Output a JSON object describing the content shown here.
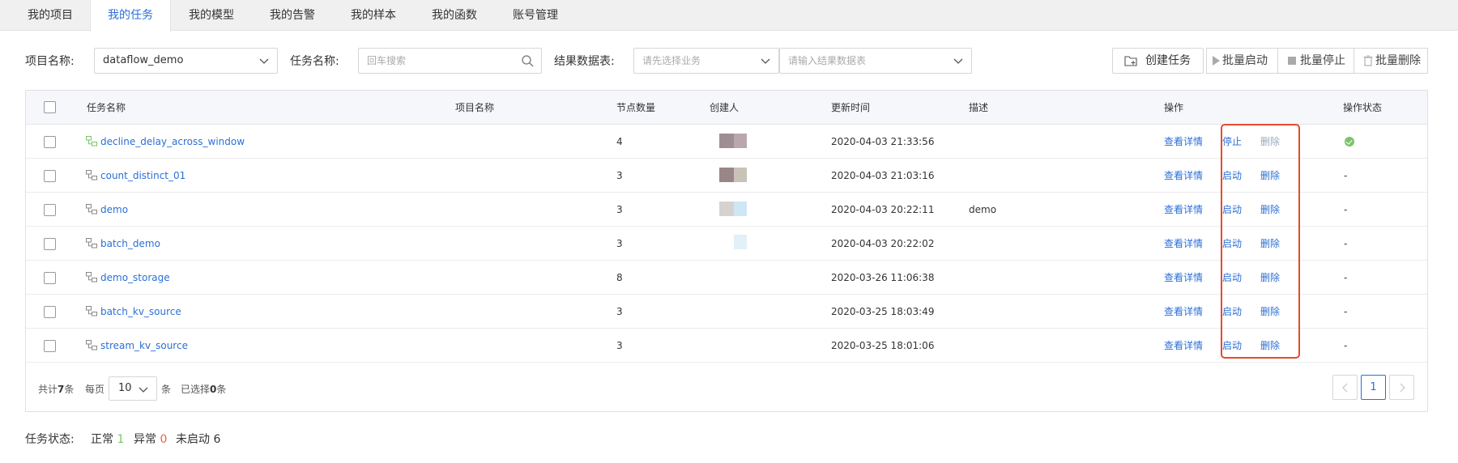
{
  "tabs": [
    "我的项目",
    "我的任务",
    "我的模型",
    "我的告警",
    "我的样本",
    "我的函数",
    "账号管理"
  ],
  "active_tab": "我的任务",
  "filters": {
    "project_label": "项目名称:",
    "project_value": "dataflow_demo",
    "task_label": "任务名称:",
    "task_placeholder": "回车搜索",
    "result_label": "结果数据表:",
    "business_placeholder": "请先选择业务",
    "table_placeholder": "请输入结果数据表"
  },
  "actions": {
    "create": "创建任务",
    "batch_start": "批量启动",
    "batch_stop": "批量停止",
    "batch_delete": "批量删除"
  },
  "columns": {
    "name": "任务名称",
    "project": "项目名称",
    "nodes": "节点数量",
    "creator": "创建人",
    "updated": "更新时间",
    "desc": "描述",
    "ops": "操作",
    "op_status": "操作状态"
  },
  "rows": [
    {
      "name": "decline_delay_across_window",
      "nodes": "4",
      "updated": "2020-04-03 21:33:56",
      "desc": "",
      "detail": "查看详情",
      "toggle": "停止",
      "delete": "删除",
      "delete_disabled": true,
      "status": "ok",
      "status_text": "",
      "running": true
    },
    {
      "name": "count_distinct_01",
      "nodes": "3",
      "updated": "2020-04-03 21:03:16",
      "desc": "",
      "detail": "查看详情",
      "toggle": "启动",
      "delete": "删除",
      "delete_disabled": false,
      "status": "none",
      "status_text": "-",
      "running": false
    },
    {
      "name": "demo",
      "nodes": "3",
      "updated": "2020-04-03 20:22:11",
      "desc": "demo",
      "detail": "查看详情",
      "toggle": "启动",
      "delete": "删除",
      "delete_disabled": false,
      "status": "none",
      "status_text": "-",
      "running": false
    },
    {
      "name": "batch_demo",
      "nodes": "3",
      "updated": "2020-04-03 20:22:02",
      "desc": "",
      "detail": "查看详情",
      "toggle": "启动",
      "delete": "删除",
      "delete_disabled": false,
      "status": "none",
      "status_text": "-",
      "running": false
    },
    {
      "name": "demo_storage",
      "nodes": "8",
      "updated": "2020-03-26 11:06:38",
      "desc": "",
      "detail": "查看详情",
      "toggle": "启动",
      "delete": "删除",
      "delete_disabled": false,
      "status": "none",
      "status_text": "-",
      "running": false
    },
    {
      "name": "batch_kv_source",
      "nodes": "3",
      "updated": "2020-03-25 18:03:49",
      "desc": "",
      "detail": "查看详情",
      "toggle": "启动",
      "delete": "删除",
      "delete_disabled": false,
      "status": "none",
      "status_text": "-",
      "running": false
    },
    {
      "name": "stream_kv_source",
      "nodes": "3",
      "updated": "2020-03-25 18:01:06",
      "desc": "",
      "detail": "查看详情",
      "toggle": "启动",
      "delete": "删除",
      "delete_disabled": false,
      "status": "none",
      "status_text": "-",
      "running": false
    }
  ],
  "footer": {
    "total_prefix": "共计",
    "total": "7",
    "total_suffix": "条",
    "per_page_label": "每页",
    "per_page": "10",
    "per_page_unit": "条",
    "selected_prefix": "已选择",
    "selected": "0",
    "selected_suffix": "条",
    "current_page": "1"
  },
  "task_status": {
    "label": "任务状态:",
    "normal_label": "正常",
    "normal_count": "1",
    "abnormal_label": "异常",
    "abnormal_count": "0",
    "not_started_label": "未启动",
    "not_started_count": "6"
  },
  "colors": {
    "accent": "#2b6fd6",
    "highlight_box": "#e84a2b",
    "ok_green": "#7ac36a",
    "error_orange": "#f0643c"
  }
}
